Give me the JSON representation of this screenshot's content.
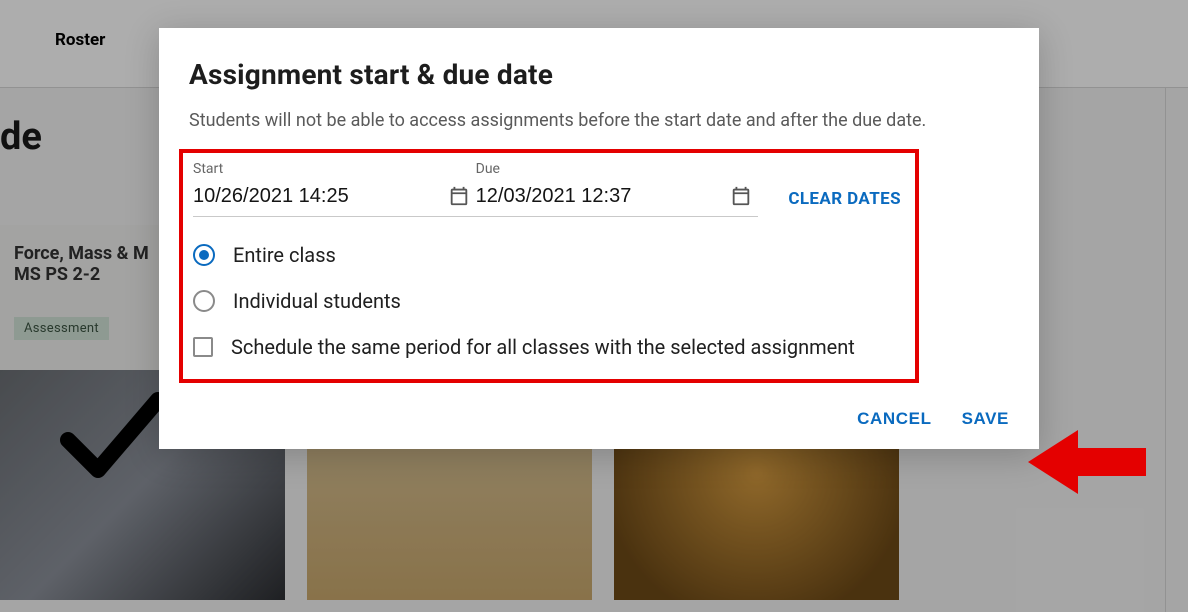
{
  "nav": {
    "roster_tab": "Roster"
  },
  "page": {
    "title_fragment": "de",
    "card": {
      "line1": "Force, Mass & M",
      "line2": "MS PS 2-2",
      "badge": "Assessment"
    }
  },
  "modal": {
    "title": "Assignment start & due date",
    "description": "Students will not be able to access assignments before the start date and after the due date.",
    "start": {
      "label": "Start",
      "value": "10/26/2021 14:25"
    },
    "due": {
      "label": "Due",
      "value": "12/03/2021 12:37"
    },
    "clear_dates_label": "CLEAR DATES",
    "audience": {
      "entire_class": "Entire class",
      "individual_students": "Individual students",
      "selected": "entire_class"
    },
    "schedule_all_checkbox": {
      "label": "Schedule the same period for all classes with the selected assignment",
      "checked": false
    },
    "actions": {
      "cancel": "CANCEL",
      "save": "SAVE"
    }
  },
  "annotation": {
    "highlight_color": "#e40000",
    "arrow_target": "save-button"
  }
}
